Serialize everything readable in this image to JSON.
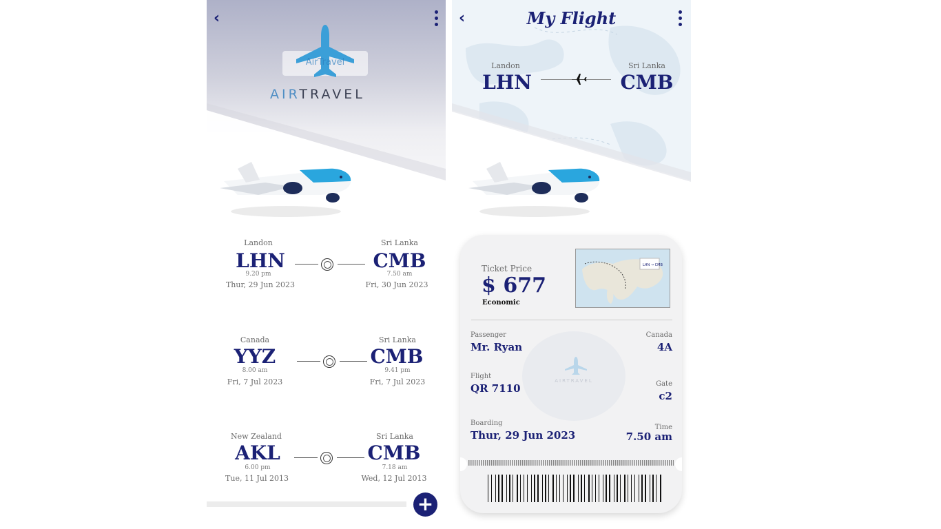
{
  "left_screen": {
    "logo": {
      "text_air": "AIR",
      "text_travel": "TRAVEL",
      "emblem_text": "AirTravel"
    },
    "routes": [
      {
        "from_city": "Landon",
        "from_code": "LHN",
        "from_time": "9.20 pm",
        "from_date": "Thur, 29  Jun 2023",
        "to_city": "Sri Lanka",
        "to_code": "CMB",
        "to_time": "7.50 am",
        "to_date": "Fri, 30 Jun 2023"
      },
      {
        "from_city": "Canada",
        "from_code": "YYZ",
        "from_time": "8.00 am",
        "from_date": "Fri, 7  Jul 2023",
        "to_city": "Sri Lanka",
        "to_code": "CMB",
        "to_time": "9.41  pm",
        "to_date": "Fri, 7  Jul 2023"
      },
      {
        "from_city": "New Zealand",
        "from_code": "AKL",
        "from_time": "6.00 pm",
        "from_date": "Tue, 11 Jul 2013",
        "to_city": "Sri Lanka",
        "to_code": "CMB",
        "to_time": "7.18 am",
        "to_date": "Wed, 12 Jul 2013"
      }
    ],
    "add_button": "+"
  },
  "right_screen": {
    "title": "My Flight",
    "route": {
      "from_city": "Landon",
      "from_code": "LHN",
      "to_city": "Sri Lanka",
      "to_code": "CMB"
    },
    "ticket": {
      "price_label": "Ticket Price",
      "price": "$ 677",
      "class": "Economic",
      "map_caption_from": "LHN",
      "map_caption_to": "CMB",
      "passenger_label": "Passenger",
      "passenger": "Mr. Ryan",
      "seat_label": "Canada",
      "seat": "4A",
      "flight_label": "Flight",
      "flight": "QR 7110",
      "gate_label": "Gate",
      "gate": "c2",
      "boarding_label": "Boarding",
      "boarding": "Thur, 29  Jun 2023",
      "time_label": "Time",
      "time": "7.50 am",
      "watermark": "AIRTRAVEL"
    }
  },
  "colors": {
    "navy": "#1b2175",
    "sky_blue": "#3b9fd8",
    "ticket_bg": "#f2f2f3"
  }
}
